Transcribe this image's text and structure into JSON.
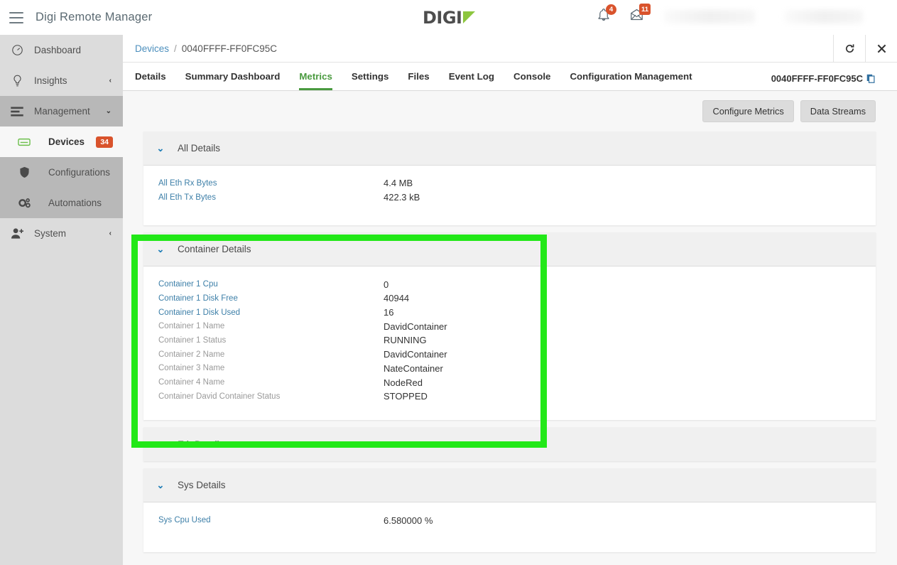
{
  "header": {
    "app_title": "Digi Remote Manager",
    "menu_icon": "hamburger-icon",
    "logo_text": "DIGI",
    "notifications": {
      "icon": "bell-icon",
      "count": "4"
    },
    "messages": {
      "icon": "envelope-icon",
      "count": "11"
    }
  },
  "sidebar": {
    "items": [
      {
        "label": "Dashboard",
        "icon": "gauge-icon",
        "chevron": ""
      },
      {
        "label": "Insights",
        "icon": "lightbulb-icon",
        "chevron": "‹"
      },
      {
        "label": "Management",
        "icon": "list-icon",
        "chevron": "⌄"
      },
      {
        "label": "Devices",
        "icon": "server-icon",
        "badge": "34"
      },
      {
        "label": "Configurations",
        "icon": "shield-icon"
      },
      {
        "label": "Automations",
        "icon": "gears-icon"
      },
      {
        "label": "System",
        "icon": "user-add-icon",
        "chevron": "‹"
      }
    ]
  },
  "breadcrumb": {
    "root": "Devices",
    "separator": "/",
    "current": "0040FFFF-FF0FC95C",
    "refresh_icon": "refresh-icon",
    "close_icon": "close-icon"
  },
  "tabs": [
    {
      "label": "Details",
      "active": false
    },
    {
      "label": "Summary Dashboard",
      "active": false
    },
    {
      "label": "Metrics",
      "active": true
    },
    {
      "label": "Settings",
      "active": false
    },
    {
      "label": "Files",
      "active": false
    },
    {
      "label": "Event Log",
      "active": false
    },
    {
      "label": "Console",
      "active": false
    },
    {
      "label": "Configuration Management",
      "active": false
    }
  ],
  "device_id": "0040FFFF-FF0FC95C",
  "copy_icon": "copy-icon",
  "toolbar": {
    "configure_metrics": "Configure Metrics",
    "data_streams": "Data Streams"
  },
  "sections": [
    {
      "title": "All Details",
      "expanded": true,
      "chevron": "⌄",
      "rows": [
        {
          "label": "All Eth Rx Bytes",
          "value": "4.4 MB",
          "link": true
        },
        {
          "label": "All Eth Tx Bytes",
          "value": "422.3 kB",
          "link": true
        }
      ]
    },
    {
      "title": "Container Details",
      "expanded": true,
      "chevron": "⌄",
      "rows": [
        {
          "label": "Container 1 Cpu",
          "value": "0",
          "link": true
        },
        {
          "label": "Container 1 Disk Free",
          "value": "40944",
          "link": true
        },
        {
          "label": "Container 1 Disk Used",
          "value": "16",
          "link": true
        },
        {
          "label": "Container 1 Name",
          "value": "DavidContainer",
          "link": false
        },
        {
          "label": "Container 1 Status",
          "value": "RUNNING",
          "link": false
        },
        {
          "label": "Container 2 Name",
          "value": "DavidContainer",
          "link": false
        },
        {
          "label": "Container 3 Name",
          "value": "NateContainer",
          "link": false
        },
        {
          "label": "Container 4 Name",
          "value": "NodeRed",
          "link": false
        },
        {
          "label": "Container David Container Status",
          "value": "STOPPED",
          "link": false
        }
      ]
    },
    {
      "title": "Eth Details",
      "expanded": false,
      "chevron": "›",
      "rows": []
    },
    {
      "title": "Sys Details",
      "expanded": true,
      "chevron": "⌄",
      "rows": [
        {
          "label": "Sys Cpu Used",
          "value": "6.580000 %",
          "link": true
        }
      ]
    }
  ],
  "annotation": {
    "color": "#22e818",
    "target": "container-details-section"
  }
}
